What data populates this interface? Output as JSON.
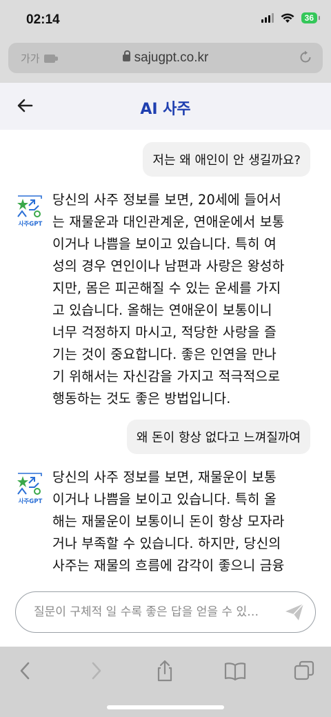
{
  "status": {
    "time": "02:14",
    "battery": "36"
  },
  "browser": {
    "aa_label": "가가",
    "url": "sajugpt.co.kr"
  },
  "header": {
    "title": "AI 사주"
  },
  "messages": [
    {
      "role": "user",
      "text": "저는 왜 애인이 안 생길까요?"
    },
    {
      "role": "bot",
      "avatar_label": "사주GPT",
      "lines": [
        "당신의 사주 정보를 보면, 20세에 들어서",
        "는 재물운과 대인관계운, 연애운에서 보통",
        "이거나 나쁨을 보이고 있습니다. 특히 여",
        "성의 경우 연인이나 남편과 사랑은 왕성하",
        "지만, 몸은 피곤해질 수 있는 운세를 가지",
        "고 있습니다. 올해는 연애운이 보통이니",
        "너무 걱정하지 마시고, 적당한 사랑을 즐",
        "기는 것이 중요합니다. 좋은 인연을 만나",
        "기 위해서는 자신감을 가지고 적극적으로",
        "행동하는 것도 좋은 방법입니다."
      ]
    },
    {
      "role": "user",
      "text": "왜 돈이 항상 없다고 느껴질까여"
    },
    {
      "role": "bot",
      "avatar_label": "사주GPT",
      "lines": [
        "당신의 사주 정보를 보면, 재물운이 보통",
        "이거나 나쁨을 보이고 있습니다. 특히 올",
        "해는 재물운이 보통이니 돈이 항상 모자라",
        "거나 부족할 수 있습니다. 하지만, 당신의",
        "사주는 재물의 흐름에 감각이 좋으니 금융"
      ]
    }
  ],
  "input": {
    "placeholder": "질문이 구체적 일 수록 좋은 답을 얻을 수 있…"
  },
  "icons": {
    "back": "arrow-left-icon",
    "send": "paper-plane-icon",
    "reload": "reload-icon",
    "lock": "lock-icon"
  },
  "colors": {
    "title": "#1f3fb0",
    "avatar_green": "#3aa84a",
    "avatar_blue": "#2a6fd6",
    "battery": "#34c759"
  }
}
